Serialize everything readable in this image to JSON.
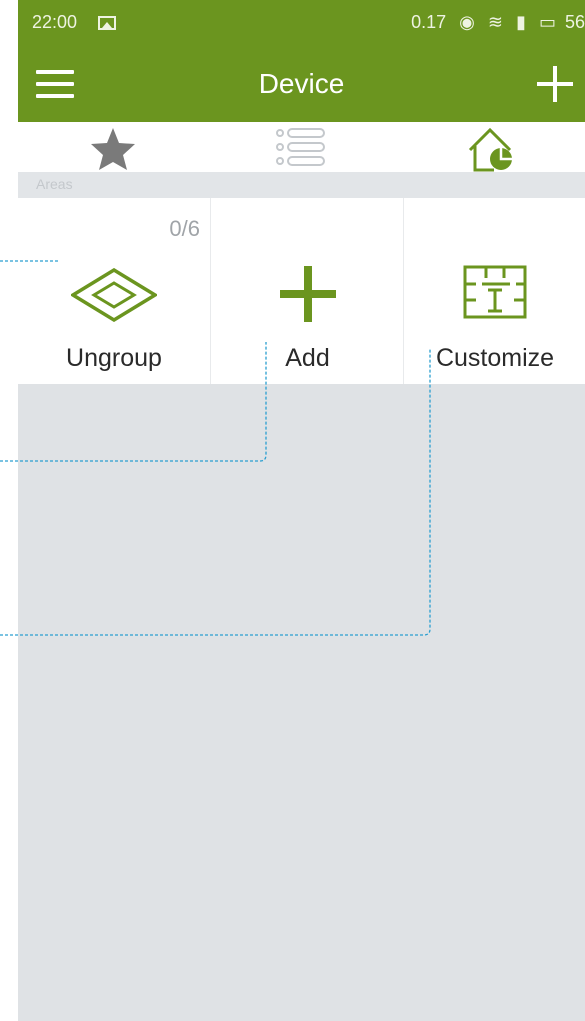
{
  "status_bar": {
    "time": "22:00",
    "data_rate": "0.17",
    "battery": "56"
  },
  "app_bar": {
    "title": "Device"
  },
  "tabs": [
    {
      "icon": "star-icon"
    },
    {
      "icon": "list-icon"
    },
    {
      "icon": "home-chart-icon",
      "active": true
    }
  ],
  "section": {
    "label": "Areas"
  },
  "tiles": [
    {
      "label": "Ungroup",
      "count": "0/6",
      "icon": "diamond-icon"
    },
    {
      "label": "Add",
      "icon": "plus-icon"
    },
    {
      "label": "Customize",
      "icon": "floorplan-icon"
    }
  ],
  "colors": {
    "brand": "#6b951f",
    "background": "#dfe2e5",
    "callout": "#2a9fd0"
  }
}
